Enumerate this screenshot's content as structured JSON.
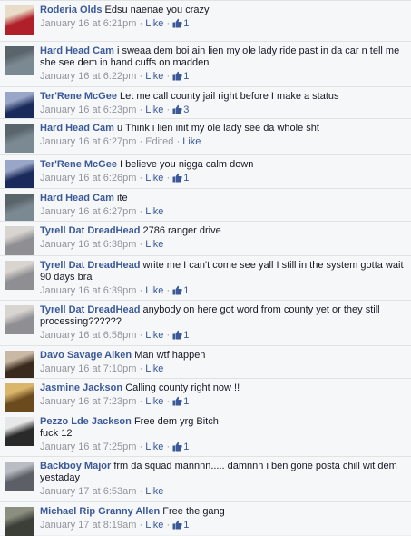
{
  "comments": [
    {
      "author": "Roderia Olds",
      "text": "Edsu naenae you crazy",
      "time": "January 16 at 6:21pm",
      "like_label": "Like",
      "likes": "1",
      "edited": "",
      "avatar_colors": [
        "#b0202a",
        "#e9dcc8"
      ]
    },
    {
      "author": "Hard Head Cam",
      "text": "i sweaa dem boi ain lien my ole lady ride past in da car n tell me she see dem in hand cuffs on madden",
      "time": "January 16 at 6:22pm",
      "like_label": "Like",
      "likes": "1",
      "edited": "",
      "avatar_colors": [
        "#7b8a92",
        "#5a646b"
      ]
    },
    {
      "author": "Ter'Rene McGee",
      "text": "Let me call county jail right before I make a status",
      "time": "January 16 at 6:23pm",
      "like_label": "Like",
      "likes": "3",
      "edited": "",
      "avatar_colors": [
        "#1a2a5a",
        "#9aa6c8"
      ]
    },
    {
      "author": "Hard Head Cam",
      "text": "u Think i lien init my ole lady see da whole sht",
      "time": "January 16 at 6:27pm",
      "like_label": "Like",
      "likes": "",
      "edited": "Edited",
      "avatar_colors": [
        "#7b8a92",
        "#5a646b"
      ]
    },
    {
      "author": "Ter'Rene McGee",
      "text": "I believe you nigga calm down",
      "time": "January 16 at 6:26pm",
      "like_label": "Like",
      "likes": "1",
      "edited": "",
      "avatar_colors": [
        "#1a2a5a",
        "#9aa6c8"
      ]
    },
    {
      "author": "Hard Head Cam",
      "text": "ite",
      "time": "January 16 at 6:27pm",
      "like_label": "Like",
      "likes": "",
      "edited": "",
      "avatar_colors": [
        "#7b8a92",
        "#5a646b"
      ]
    },
    {
      "author": "Tyrell Dat DreadHead",
      "text": "2786 ranger drive",
      "time": "January 16 at 6:38pm",
      "like_label": "Like",
      "likes": "",
      "edited": "",
      "avatar_colors": [
        "#8f8f93",
        "#d8d4cf"
      ]
    },
    {
      "author": "Tyrell Dat DreadHead",
      "text": "write me I can't come see yall I still in the system gotta wait 90 days bra",
      "time": "January 16 at 6:39pm",
      "like_label": "Like",
      "likes": "1",
      "edited": "",
      "avatar_colors": [
        "#8f8f93",
        "#d8d4cf"
      ]
    },
    {
      "author": "Tyrell Dat DreadHead",
      "text": "anybody on here got word from county yet or they still processing??????",
      "time": "January 16 at 6:58pm",
      "like_label": "Like",
      "likes": "1",
      "edited": "",
      "avatar_colors": [
        "#8f8f93",
        "#d8d4cf"
      ]
    },
    {
      "author": "Davo Savage Aiken",
      "text": "Man wtf happen",
      "time": "January 16 at 7:10pm",
      "like_label": "Like",
      "likes": "",
      "edited": "",
      "avatar_colors": [
        "#3a2a1e",
        "#c8b8a4"
      ]
    },
    {
      "author": "Jasmine Jackson",
      "text": "Calling county right now !!",
      "time": "January 16 at 7:23pm",
      "like_label": "Like",
      "likes": "1",
      "edited": "",
      "avatar_colors": [
        "#6b4a1e",
        "#d9b66a"
      ]
    },
    {
      "author": "Pezzo Lde Jackson",
      "text": "Free dem yrg Bitch\nfuck 12",
      "time": "January 16 at 7:25pm",
      "like_label": "Like",
      "likes": "1",
      "edited": "",
      "avatar_colors": [
        "#2a2a2a",
        "#e8e8e8"
      ]
    },
    {
      "author": "Backboy Major",
      "text": "frm da squad mannnn..... damnnn i ben gone posta chill wit dem yestaday",
      "time": "January 17 at 6:53am",
      "like_label": "Like",
      "likes": "",
      "edited": "",
      "avatar_colors": [
        "#5c5f66",
        "#b9bcc2"
      ]
    },
    {
      "author": "Michael Rip Granny Allen",
      "text": "Free the gang",
      "time": "January 17 at 8:19am",
      "like_label": "Like",
      "likes": "1",
      "edited": "",
      "avatar_colors": [
        "#3b3f38",
        "#8c8f80"
      ]
    }
  ]
}
